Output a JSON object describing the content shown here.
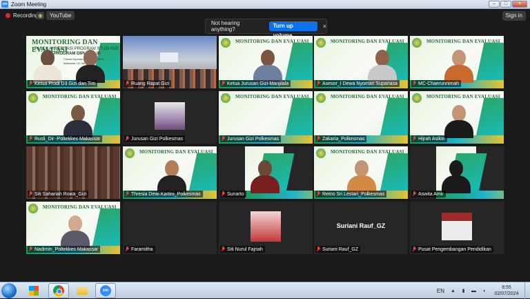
{
  "window": {
    "title": "Zoom Meeting",
    "app_icon": "zm"
  },
  "topbar": {
    "recording": "Recording",
    "youtube": "YouTube",
    "sign_in": "Sign in"
  },
  "notice": {
    "text": "Not hearing anything?",
    "button": "Turn up volume",
    "close": "×"
  },
  "slide": {
    "title": "MONITORING DAN EVALUASI",
    "subtitle": "PASCA AKREDITASI PROGRAM STUDI GIZI",
    "big_line3": "PROGRAM DIPLOMA III",
    "big_line4": "I Dewa Nyoman Supariasa, MPS",
    "big_line5": "Makassar, 02 Juli 2024"
  },
  "participants": [
    {
      "name": "Ketua Prodi D3 Gizi dan Tim"
    },
    {
      "name": "Ruang Rapat Gizi"
    },
    {
      "name": "Ketua Jurusan Gizi-Manjilala"
    },
    {
      "name": "Asesor_I Dewa Nyoman Supariasa"
    },
    {
      "name": "MC-Chaerunnimah"
    },
    {
      "name": "Rusli_Dir -Poltekkes Makassar"
    },
    {
      "name": "Jurusan Gizi Polkesmas"
    },
    {
      "name": "Jurusan Gizi Polkesmas"
    },
    {
      "name": "Zakaria_Polkesmas"
    },
    {
      "name": "Hijrah Asikin"
    },
    {
      "name": "Siti Sahariah Rowa_Gizi"
    },
    {
      "name": "Thresia Dewi Kartini_Polkesmas"
    },
    {
      "name": "Sunarto"
    },
    {
      "name": "Retno Sri Lestari_Polkesmas"
    },
    {
      "name": "Aswita Amir"
    },
    {
      "name": "Nadimin_Poltekkes Makassar"
    },
    {
      "name": "Faramitha"
    },
    {
      "name": "Siti Nurul Fajriah"
    },
    {
      "name": "Suriani Rauf_GZ"
    },
    {
      "name": "Pusat Pengembangan Pendidikan"
    }
  ],
  "center_name": "Suriani Rauf_GZ",
  "taskbar": {
    "zoom_label": "zm",
    "lang": "EN",
    "time": "8:55",
    "date": "02/07/2024"
  }
}
